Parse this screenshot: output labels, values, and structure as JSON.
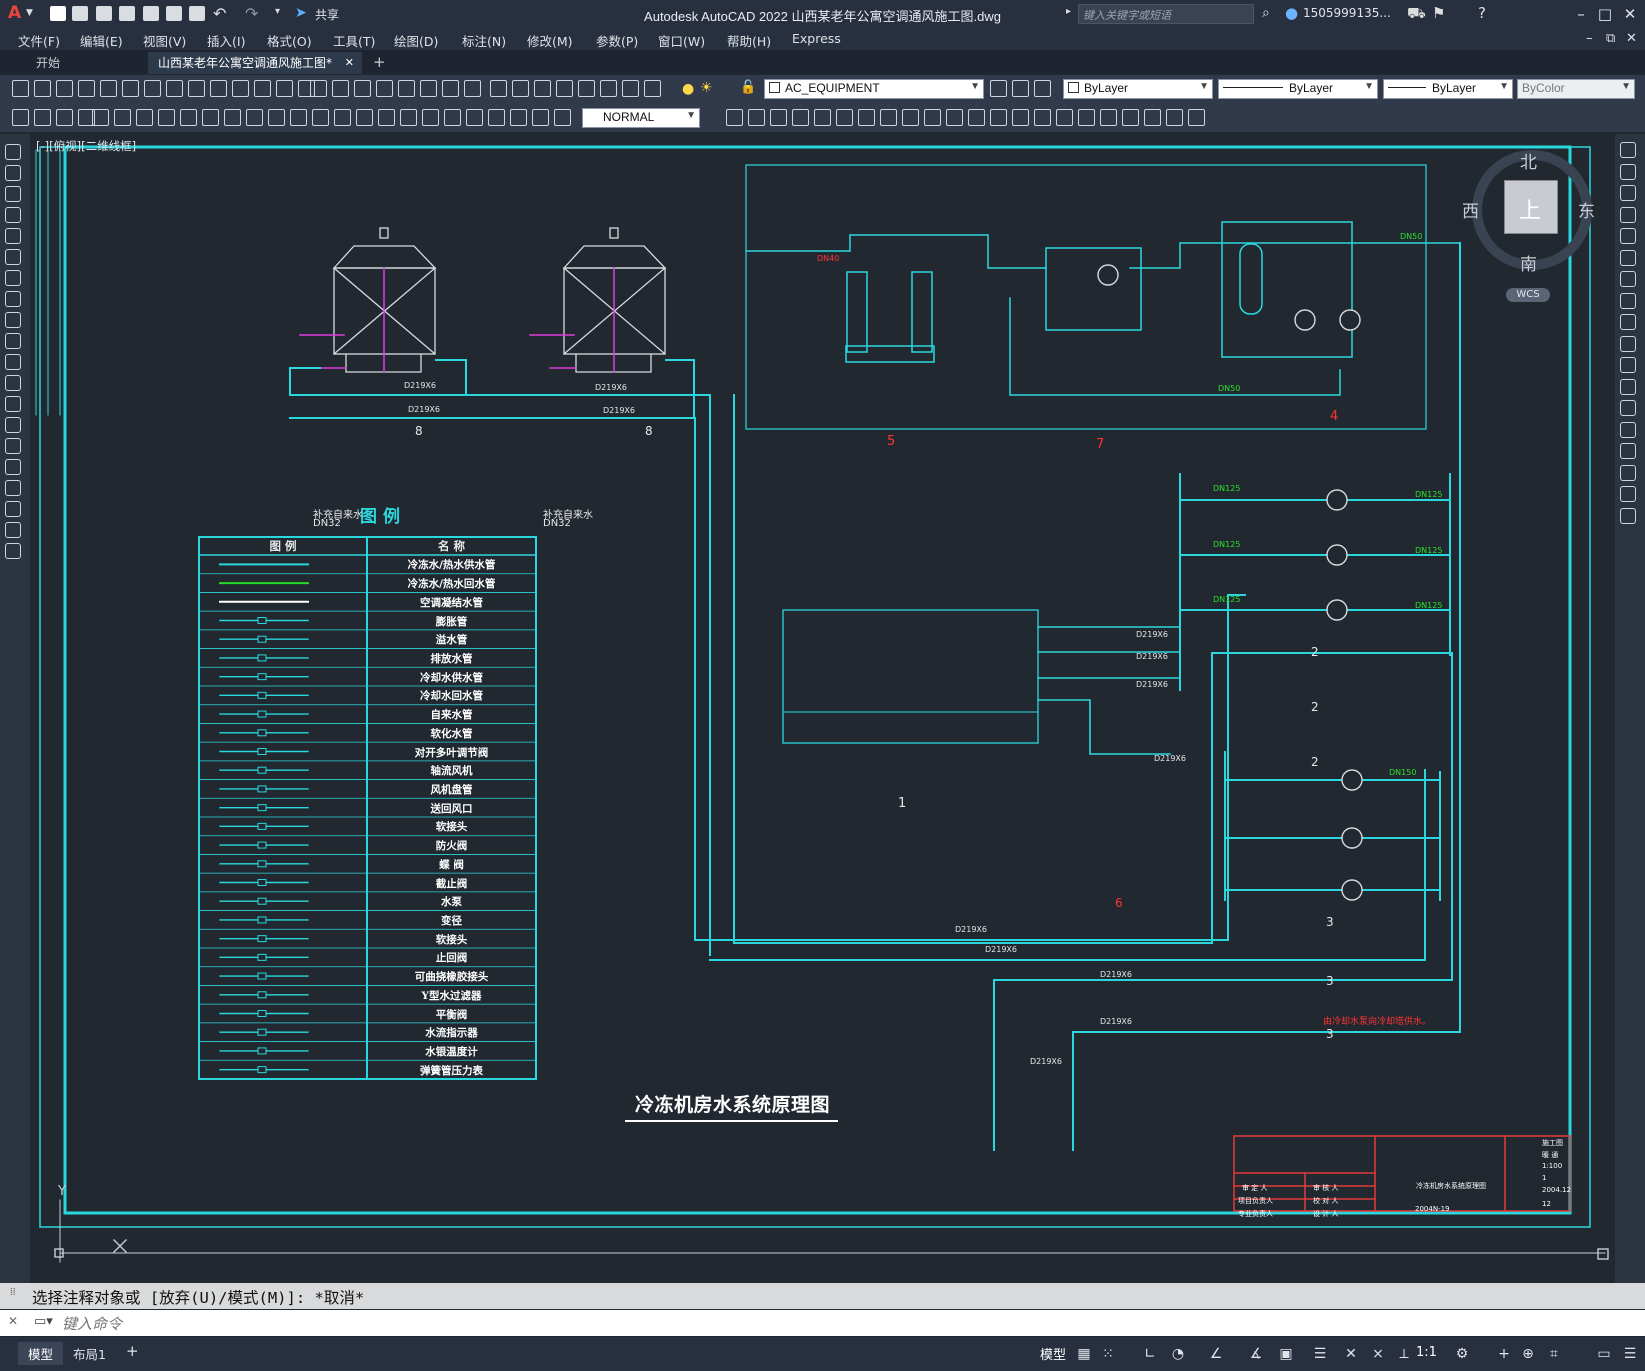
{
  "app": {
    "title": "Autodesk AutoCAD 2022    山西某老年公寓空调通风施工图.dwg",
    "share_label": "共享",
    "search_placeholder": "键入关键字或短语",
    "user": "1505999135...",
    "logo": "A"
  },
  "menu": [
    "文件(F)",
    "编辑(E)",
    "视图(V)",
    "插入(I)",
    "格式(O)",
    "工具(T)",
    "绘图(D)",
    "标注(N)",
    "修改(M)",
    "参数(P)",
    "窗口(W)",
    "帮助(H)",
    "Express"
  ],
  "tabs": [
    {
      "label": "开始",
      "active": false
    },
    {
      "label": "山西某老年公寓空调通风施工图*",
      "active": true
    }
  ],
  "toolbar": {
    "layer": "AC_EQUIPMENT",
    "color": "ByLayer",
    "linetype": "ByLayer",
    "lineweight": "ByLayer",
    "plotstyle": "ByColor",
    "dimstyle": "NORMAL"
  },
  "viewport_label": "[-][俯视][二维线框]",
  "viewcube": {
    "north": "北",
    "south": "南",
    "east": "东",
    "west": "西",
    "top": "上",
    "wcs": "WCS"
  },
  "drawing": {
    "title": "冷冻机房水系统原理图",
    "legend_title": "图    例",
    "legend_headers": [
      "图  例",
      "名  称"
    ],
    "legend_items": [
      "冷冻水/热水供水管",
      "冷冻水/热水回水管",
      "空调凝结水管",
      "膨胀管",
      "溢水管",
      "排放水管",
      "冷却水供水管",
      "冷却水回水管",
      "自来水管",
      "软化水管",
      "对开多叶调节阀",
      "轴流风机",
      "风机盘管",
      "送回风口",
      "软接头",
      "防火阀",
      "蝶 阀",
      "截止阀",
      "水泵",
      "变径",
      "软接头",
      "止回阀",
      "可曲挠橡胶接头",
      "Y型水过滤器",
      "平衡阀",
      "水流指示器",
      "水银温度计",
      "弹簧管压力表"
    ],
    "tower_labels": [
      "补充自来水",
      "DN32"
    ],
    "equipment_numbers": [
      "8",
      "8",
      "5",
      "7",
      "4",
      "1",
      "2",
      "2",
      "2",
      "3",
      "3",
      "3",
      "6"
    ],
    "pipe_sizes": [
      "D219X6",
      "DN125",
      "DN150",
      "DN50",
      "DN40"
    ],
    "note": "由冷却水泵向冷却塔供水。"
  },
  "titleblock": {
    "project_no": "2004N-19",
    "date": "2004.12",
    "scale": "1:100",
    "sheet": "12",
    "cells": [
      "审 定 人",
      "审 核 人",
      "项目负责人",
      "校 对 人",
      "专业负责人",
      "设 计 人",
      "冷冻机房水系统原理图",
      "施工图",
      "暖 通",
      "1"
    ]
  },
  "command": {
    "history": "选择注释对象或 [放弃(U)/模式(M)]: *取消*",
    "placeholder": "键入命令"
  },
  "statusbar": {
    "tabs": [
      {
        "label": "模型",
        "active": true
      },
      {
        "label": "布局1",
        "active": false
      }
    ],
    "model_button": "模型",
    "scale": "1:1"
  }
}
